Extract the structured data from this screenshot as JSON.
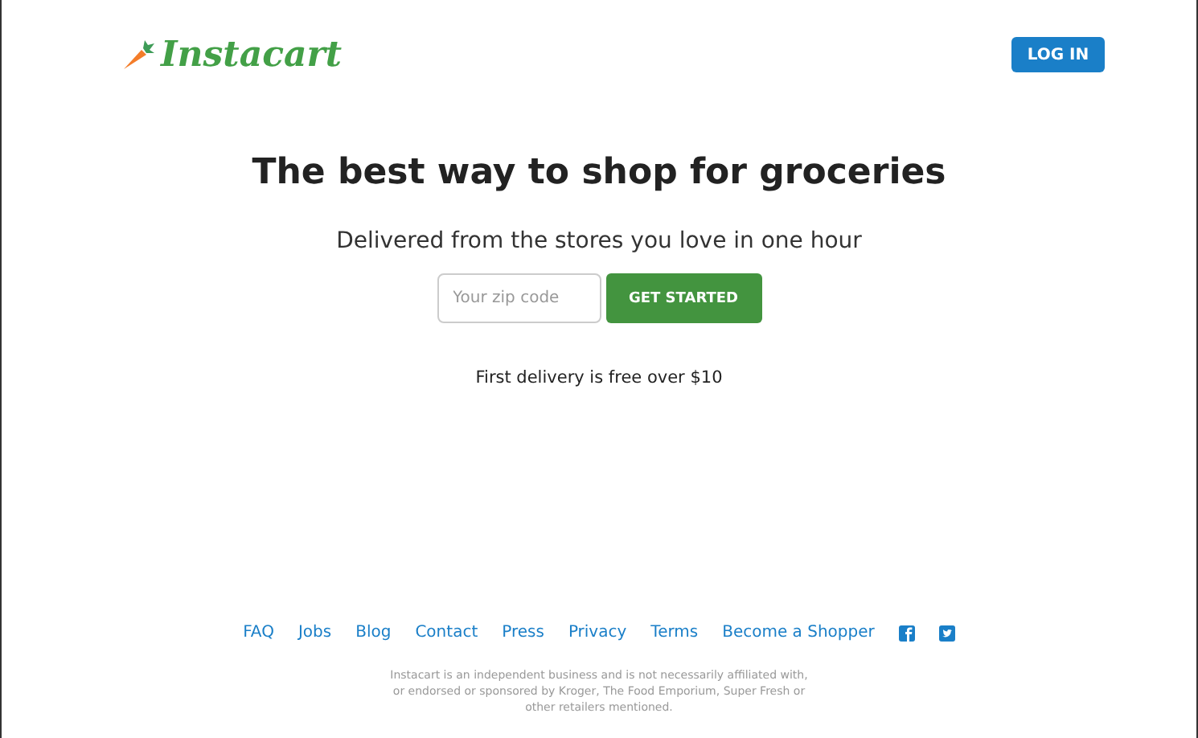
{
  "header": {
    "logo": "Instacart",
    "login_button": "LOG IN"
  },
  "hero": {
    "title": "The best way to shop for groceries",
    "subtitle": "Delivered from the stores you love in one hour",
    "zip_field": {
      "placeholder": "Your zip code"
    },
    "cta_button": "GET STARTED",
    "note": "First delivery is free over $10"
  },
  "footer": {
    "links": [
      {
        "label": "FAQ"
      },
      {
        "label": "Jobs"
      },
      {
        "label": "Blog"
      },
      {
        "label": "Contact"
      },
      {
        "label": "Press"
      },
      {
        "label": "Privacy"
      },
      {
        "label": "Terms"
      },
      {
        "label": "Become a Shopper"
      }
    ],
    "disclaimer": "Instacart is an independent business and is not necessarily affiliated with, or endorsed or sponsored by Kroger, The Food Emporium, Super Fresh or other retailers mentioned."
  }
}
